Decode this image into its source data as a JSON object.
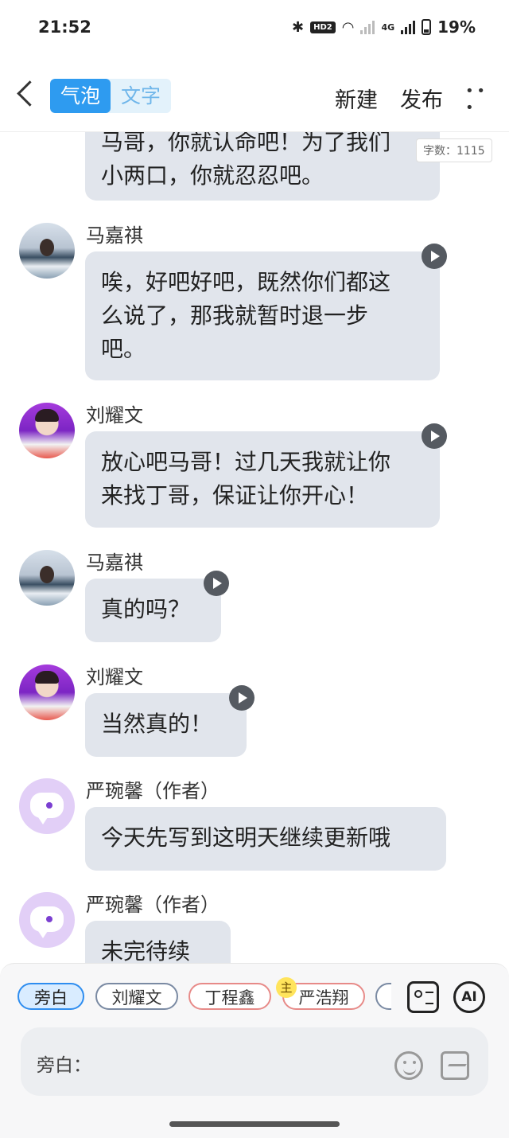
{
  "status": {
    "time": "21:52",
    "hd": "HD2",
    "network": "4G",
    "battery": "19%"
  },
  "header": {
    "tabs": [
      "气泡",
      "文字"
    ],
    "new_label": "新建",
    "publish_label": "发布"
  },
  "word_count": "字数：1115",
  "messages": [
    {
      "name": "",
      "text": "马哥，你就认命吧！为了我们\n小两口，你就忍忍吧。"
    },
    {
      "name": "马嘉祺",
      "text": "唉，好吧好吧，既然你们都这\n么说了，那我就暂时退一步\n吧。"
    },
    {
      "name": "刘耀文",
      "text": "放心吧马哥！过几天我就让你\n来找丁哥，保证让你开心！"
    },
    {
      "name": "马嘉祺",
      "text": "真的吗？"
    },
    {
      "name": "刘耀文",
      "text": "当然真的！"
    },
    {
      "name": "严琬馨（作者）",
      "text": "今天先写到这明天继续更新哦"
    },
    {
      "name": "严琬馨（作者）",
      "text": "未完待续"
    }
  ],
  "roles": [
    "旁白",
    "刘耀文",
    "丁程鑫",
    "严浩翔"
  ],
  "role_badge": "主",
  "ai_label": "AI",
  "input": {
    "placeholder": "旁白："
  }
}
